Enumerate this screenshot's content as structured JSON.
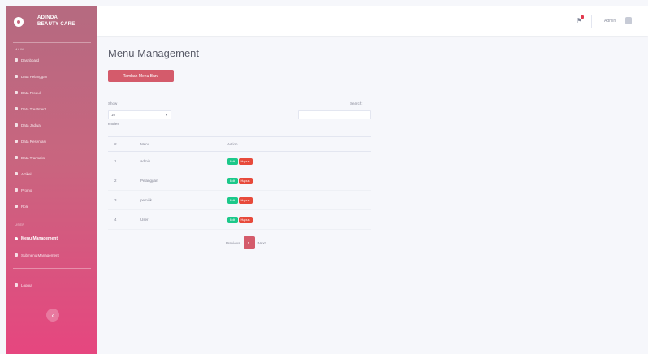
{
  "brand": {
    "line1": "ADINDA",
    "line2": "BEAUTY CARE"
  },
  "sidebar": {
    "section1": "MAIN",
    "items": [
      {
        "label": "Dashboard",
        "icon": "tachometer-icon"
      },
      {
        "label": "Data Pelanggan",
        "icon": "users-icon"
      },
      {
        "label": "Data Produk",
        "icon": "box-icon"
      },
      {
        "label": "Data Treatment",
        "icon": "spa-icon"
      },
      {
        "label": "Data Jadwal",
        "icon": "calendar-icon"
      },
      {
        "label": "Data Reservasi",
        "icon": "book-icon"
      },
      {
        "label": "Data Transaksi",
        "icon": "cash-icon"
      },
      {
        "label": "Artikel",
        "icon": "newspaper-icon"
      },
      {
        "label": "Promo",
        "icon": "tag-icon"
      },
      {
        "label": "Role",
        "icon": "key-icon"
      }
    ],
    "section2": "USER",
    "items2": [
      {
        "label": "Menu Management",
        "icon": "circle-icon",
        "active": true
      },
      {
        "label": "Submenu Management",
        "icon": "list-icon"
      }
    ],
    "logout": "Logout",
    "toggle_icon": "‹"
  },
  "topbar": {
    "user_name": "Admin"
  },
  "main": {
    "title": "Menu Management",
    "add_button": "Tambah Menu Baru",
    "show_label": "Show",
    "entries_value": "10",
    "entries_label": "entries",
    "search_label": "Search:",
    "table": {
      "headers": [
        "#",
        "Menu",
        "Action"
      ],
      "rows": [
        {
          "no": "1",
          "menu": "admin"
        },
        {
          "no": "2",
          "menu": "Pelanggan"
        },
        {
          "no": "3",
          "menu": "pemilik"
        },
        {
          "no": "4",
          "menu": "User"
        }
      ],
      "edit_label": "Edit",
      "delete_label": "Hapus"
    },
    "pagination": {
      "previous": "Previous",
      "page": "1",
      "next": "Next"
    }
  },
  "colors": {
    "accent": "#d45b6b",
    "edit": "#1cc88a",
    "delete": "#e74a3b"
  }
}
